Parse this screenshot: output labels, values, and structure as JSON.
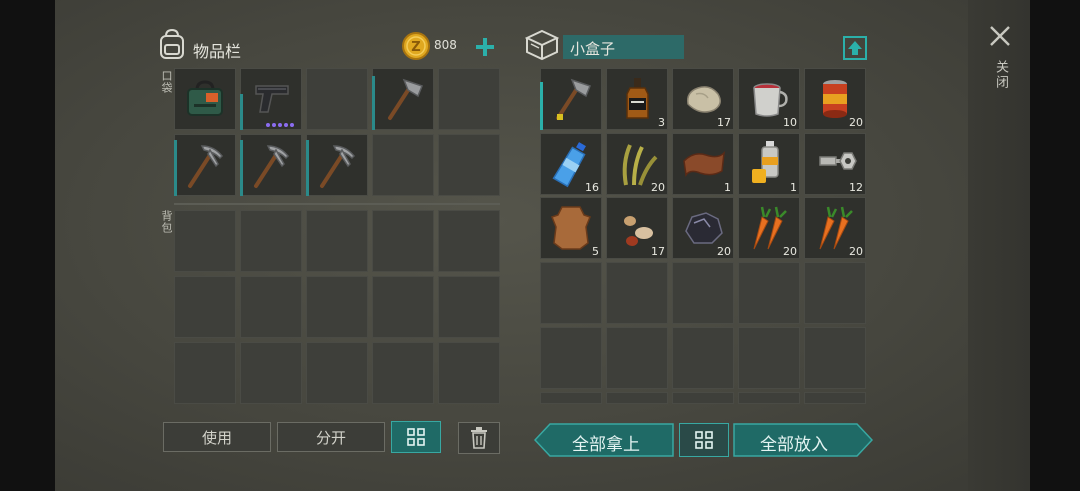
{
  "inventory": {
    "title": "物品栏",
    "coins": "808",
    "pocket_label": "口袋",
    "backpack_label": "背包",
    "pocket_items": [
      {
        "icon": "medkit-bag-icon",
        "count": ""
      },
      {
        "icon": "pistol-icon",
        "count": ""
      },
      {
        "icon": "",
        "count": ""
      },
      {
        "icon": "hatchet-icon",
        "count": ""
      },
      {
        "icon": "",
        "count": ""
      },
      {
        "icon": "pickaxe-icon",
        "count": ""
      },
      {
        "icon": "pickaxe-icon",
        "count": ""
      },
      {
        "icon": "pickaxe-icon",
        "count": ""
      },
      {
        "icon": "",
        "count": ""
      },
      {
        "icon": "",
        "count": ""
      }
    ],
    "buttons": {
      "use": "使用",
      "split": "分开"
    }
  },
  "container": {
    "title": "小盒子",
    "items": [
      {
        "icon": "hatchet-icon",
        "count": ""
      },
      {
        "icon": "whiskey-bottle-icon",
        "count": "3"
      },
      {
        "icon": "stone-icon",
        "count": "17"
      },
      {
        "icon": "metal-cup-icon",
        "count": "10"
      },
      {
        "icon": "canned-food-icon",
        "count": "20"
      },
      {
        "icon": "water-bottle-icon",
        "count": "16"
      },
      {
        "icon": "plant-fiber-icon",
        "count": "20"
      },
      {
        "icon": "leather-icon",
        "count": "1"
      },
      {
        "icon": "spray-can-icon",
        "count": "1"
      },
      {
        "icon": "bolts-nuts-icon",
        "count": "12"
      },
      {
        "icon": "animal-hide-icon",
        "count": "5"
      },
      {
        "icon": "seeds-icon",
        "count": "17"
      },
      {
        "icon": "coal-ore-icon",
        "count": "20"
      },
      {
        "icon": "carrot-icon",
        "count": "20"
      },
      {
        "icon": "carrot-icon",
        "count": "20"
      }
    ],
    "buttons": {
      "take_all": "全部拿上",
      "put_all": "全部放入"
    }
  },
  "close_label": "关闭",
  "colors": {
    "accent": "#2b8a8a",
    "button_teal": "#1f6a66",
    "coin": "#e0a820"
  }
}
